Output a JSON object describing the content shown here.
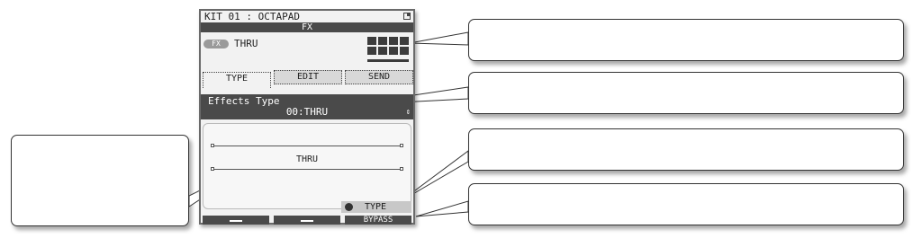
{
  "screen": {
    "kit_title": "KIT 01 : OCTAPAD",
    "header": "FX",
    "fx_badge": "FX",
    "fx_value": "THRU",
    "tabs": [
      {
        "label": "TYPE",
        "active": true
      },
      {
        "label": "EDIT",
        "active": false
      },
      {
        "label": "SEND",
        "active": false
      }
    ],
    "parameter": {
      "label": "Effects Type",
      "value": "00:THRU"
    },
    "graph_label": "THRU",
    "type_status": "TYPE",
    "function_bar": {
      "bypass": "BYPASS"
    }
  },
  "colors": {
    "lcd_background": "#f2f2f2",
    "lcd_dark": "#4a4a4a",
    "callout_border": "#333333"
  },
  "icons": [
    "corner-icon",
    "pad-grid-icon",
    "scroll-arrow-icon",
    "status-dot-icon"
  ]
}
